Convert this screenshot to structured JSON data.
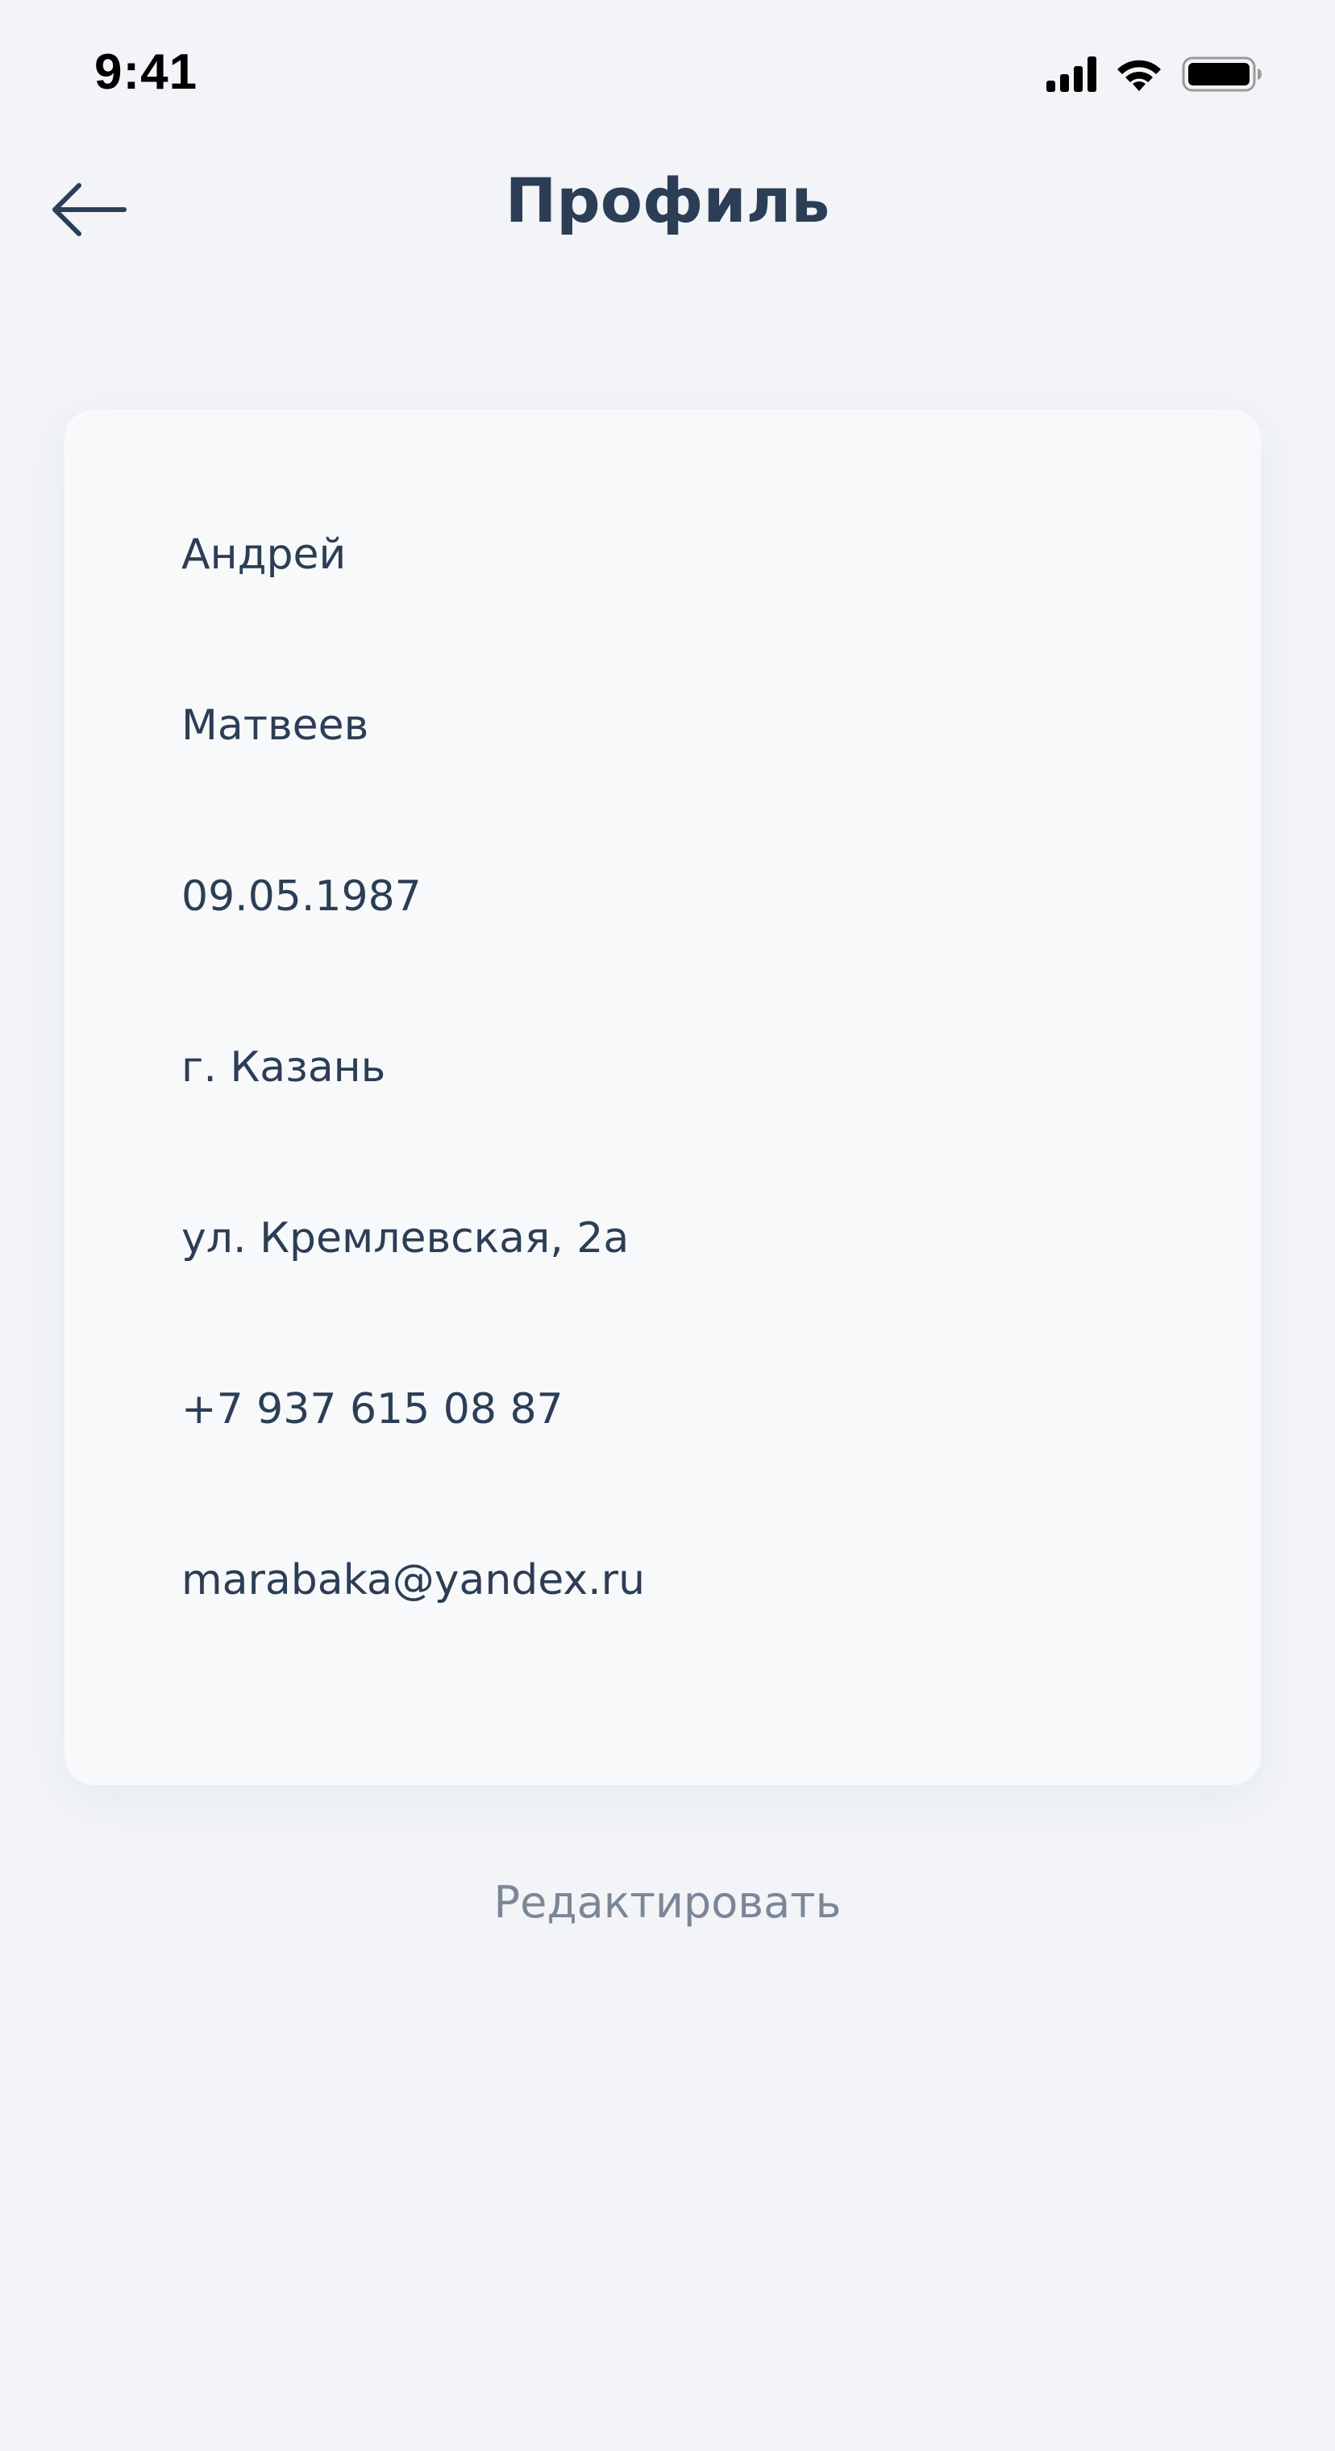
{
  "status_bar": {
    "time": "9:41"
  },
  "header": {
    "title": "Профиль",
    "back_icon": "arrow-left-icon"
  },
  "profile": {
    "first_name": "Андрей",
    "last_name": "Матвеев",
    "birth_date": "09.05.1987",
    "city": "г. Казань",
    "street": "ул. Кремлевская, 2а",
    "phone": "+7 937 615 08 87",
    "email": "marabaka@yandex.ru"
  },
  "actions": {
    "edit_label": "Редактировать"
  },
  "colors": {
    "background": "#f2f4f8",
    "card": "#f8f9fb",
    "text": "#2c3e55",
    "secondary_text": "#7b8798"
  }
}
